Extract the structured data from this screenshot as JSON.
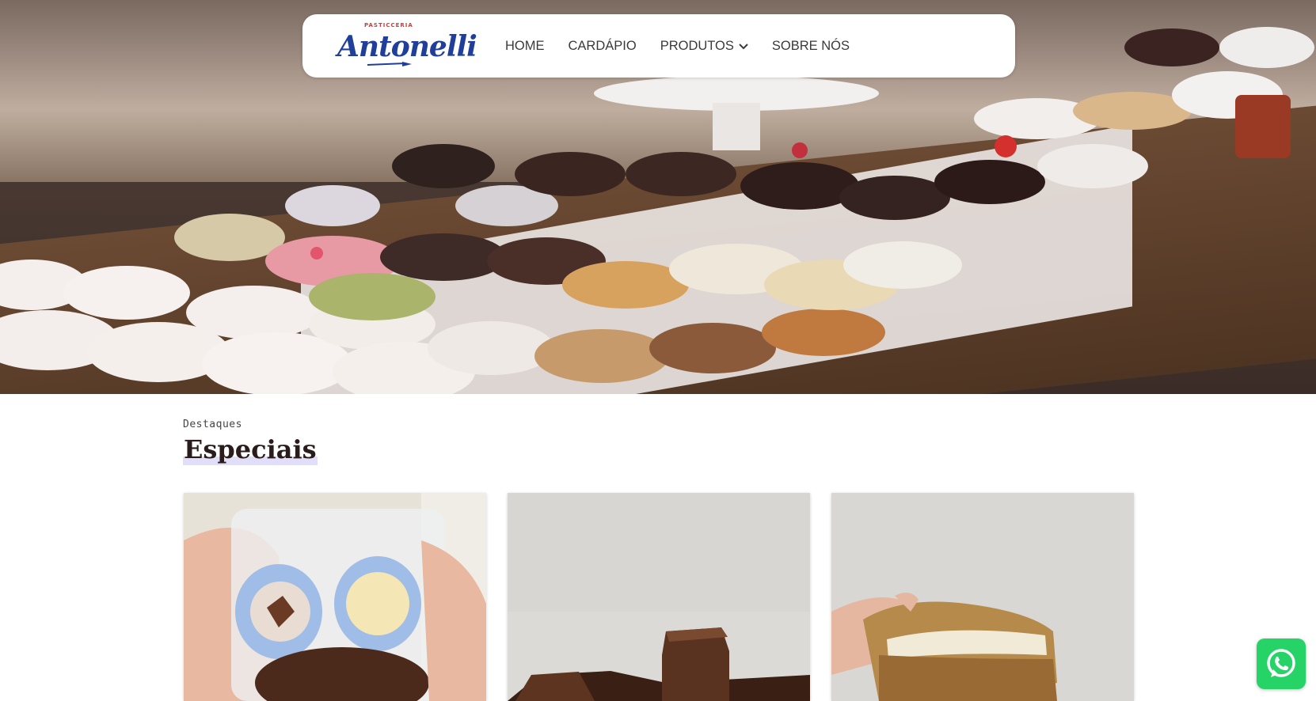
{
  "brand": {
    "tagline": "PASTICCERIA",
    "name": "Antonelli",
    "primary_color": "#1f3f9a",
    "accent_color": "#d33a3a"
  },
  "nav": {
    "items": [
      {
        "label": "HOME"
      },
      {
        "label": "CARDÁPIO"
      },
      {
        "label": "PRODUTOS",
        "has_dropdown": true,
        "icon": "chevron-down-icon"
      },
      {
        "label": "SOBRE NÓS"
      }
    ]
  },
  "hero": {
    "image": "pastry-display-photo"
  },
  "featured": {
    "eyebrow": "Destaques",
    "title": "Especiais",
    "highlight_color": "#e0def8",
    "cards": [
      {
        "image": "brigadeiros-box-photo"
      },
      {
        "image": "chocolate-fudge-photo"
      },
      {
        "image": "stuffed-cookie-photo"
      }
    ]
  },
  "whatsapp": {
    "icon": "whatsapp-icon",
    "color": "#25d366"
  }
}
